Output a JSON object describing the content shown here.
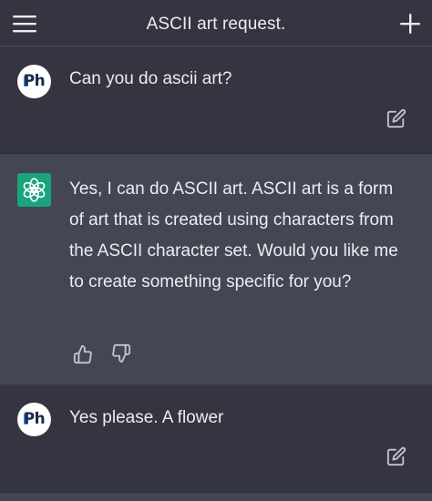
{
  "header": {
    "title": "ASCII art request.",
    "menu_icon": "hamburger-menu-icon",
    "new_chat_icon": "plus-icon"
  },
  "messages": [
    {
      "role": "user",
      "avatar": "Ph",
      "text": "Can you do ascii art?",
      "action_icon": "edit-icon"
    },
    {
      "role": "assistant",
      "avatar_icon": "openai-logo-icon",
      "text": "Yes, I can do ASCII art. ASCII art is a form of art that is created using characters from the ASCII character set. Would you like me to create something specific for you?",
      "action_icons": [
        "thumbs-up-icon",
        "thumbs-down-icon"
      ]
    },
    {
      "role": "user",
      "avatar": "Ph",
      "text": "Yes please. A flower",
      "action_icon": "edit-icon"
    }
  ],
  "colors": {
    "background": "#343541",
    "assistant_background": "#444654",
    "text": "#ececf1",
    "icon": "#c5c5d2",
    "openai_green": "#19a47e"
  }
}
